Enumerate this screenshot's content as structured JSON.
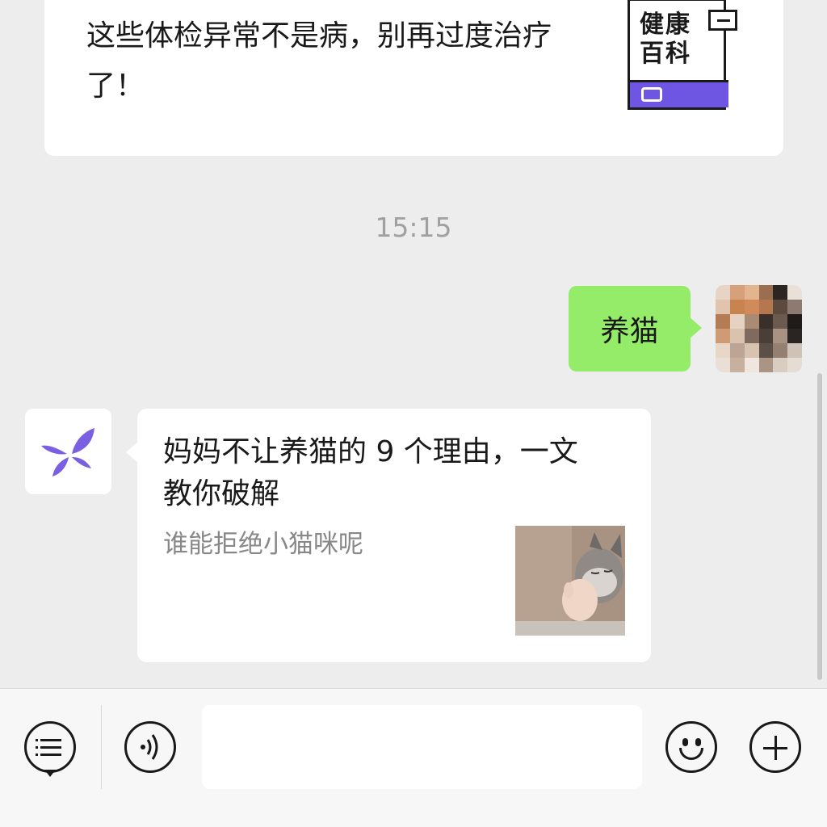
{
  "chat": {
    "top_article": {
      "title": "这些体检异常不是病，别再过度治疗了！",
      "badge": "健康百科"
    },
    "timestamp": "15:15",
    "outgoing_message": "养猫",
    "incoming_article": {
      "title": "妈妈不让养猫的 9 个理由，一文教你破解",
      "description": "谁能拒绝小猫咪呢"
    }
  },
  "colors": {
    "background": "#ededed",
    "outgoing_bubble": "#95ec69",
    "badge_accent": "#6f56e2",
    "bot_logo": "#7a5fe0"
  },
  "icons": {
    "menu": "menu-list-icon",
    "voice": "voice-icon",
    "emoji": "emoji-icon",
    "more": "plus-icon"
  }
}
